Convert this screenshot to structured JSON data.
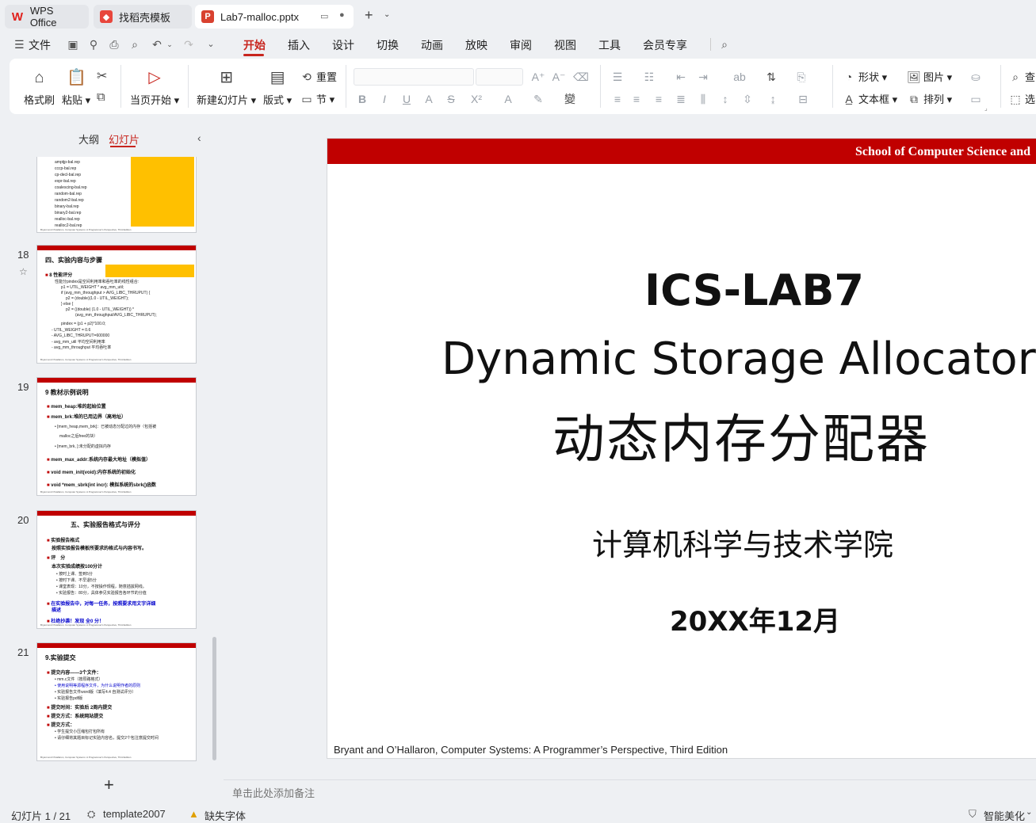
{
  "tabs": {
    "wps": "WPS Office",
    "template": "找稻壳模板",
    "document": "Lab7-malloc.pptx"
  },
  "menu": {
    "file": "文件",
    "items": [
      "开始",
      "插入",
      "设计",
      "切换",
      "动画",
      "放映",
      "审阅",
      "视图",
      "工具",
      "会员专享"
    ],
    "active": "开始"
  },
  "ribbon": {
    "format_painter": "格式刷",
    "paste": "粘贴",
    "from_current": "当页开始",
    "new_slide": "新建幻灯片",
    "layout": "版式",
    "reset": "重置",
    "section": "节",
    "shape": "形状",
    "picture": "图片",
    "textbox": "文本框",
    "arrange": "排列",
    "find": "查",
    "select": "选"
  },
  "left_panel": {
    "outline_tab": "大纲",
    "slides_tab": "幻灯片",
    "slides": [
      {
        "number": "18",
        "title": "四、实验内容与步骤"
      },
      {
        "number": "19",
        "title": "9 教材示例说明"
      },
      {
        "number": "20",
        "title": "五、实验报告格式与评分"
      },
      {
        "number": "21",
        "title": "9.实验提交"
      }
    ]
  },
  "slide": {
    "header": "School of Computer Science and",
    "title_line1": "ICS-LAB7",
    "title_line2": "Dynamic Storage Allocator",
    "title_line3": "动态内存分配器",
    "department": "计算机科学与技术学院",
    "date": "20XX年12月",
    "footer": "Bryant and O’Hallaron, Computer Systems: A Programmer’s Perspective, Third Edition"
  },
  "notes_placeholder": "单击此处添加备注",
  "status": {
    "slide_count": "幻灯片 1 / 21",
    "template": "template2007",
    "missing_font": "缺失字体",
    "smart_beautify": "智能美化"
  },
  "colors": {
    "accent": "#c8251e",
    "slide_bar": "#c00000"
  }
}
